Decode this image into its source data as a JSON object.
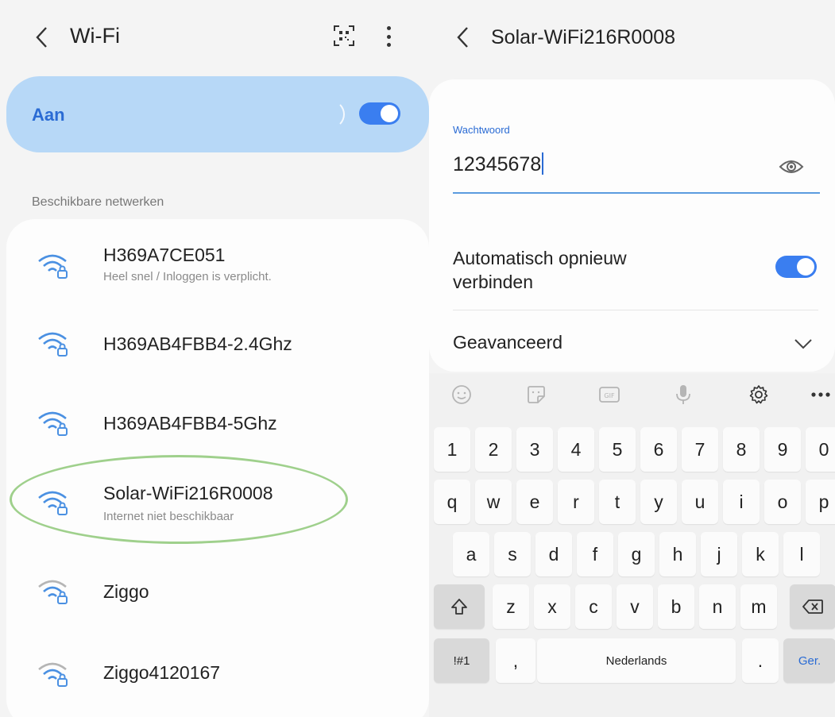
{
  "wifi_list": {
    "title": "Wi-Fi",
    "on_label": "Aan",
    "section_label": "Beschikbare netwerken",
    "networks": [
      {
        "name": "H369A7CE051",
        "status": "Heel snel / Inloggen is verplicht."
      },
      {
        "name": "H369AB4FBB4-2.4Ghz",
        "status": ""
      },
      {
        "name": "H369AB4FBB4-5Ghz",
        "status": ""
      },
      {
        "name": "Solar-WiFi216R0008",
        "status": "Internet niet beschikbaar"
      },
      {
        "name": "Ziggo",
        "status": ""
      },
      {
        "name": "Ziggo4120167",
        "status": ""
      }
    ],
    "highlighted_network": "Solar-WiFi216R0008",
    "wifi_enabled": true
  },
  "network_detail": {
    "title": "Solar-WiFi216R0008",
    "password_label": "Wachtwoord",
    "password_value": "12345678",
    "auto_reconnect_label": "Automatisch opnieuw verbinden",
    "auto_reconnect_enabled": true,
    "advanced_label": "Geavanceerd"
  },
  "keyboard": {
    "toolbar_icons": [
      "emoji-icon",
      "sticker-icon",
      "gif-icon",
      "microphone-icon",
      "gear-icon",
      "more-icon"
    ],
    "row_numbers": [
      "1",
      "2",
      "3",
      "4",
      "5",
      "6",
      "7",
      "8",
      "9",
      "0"
    ],
    "row_top": [
      "q",
      "w",
      "e",
      "r",
      "t",
      "y",
      "u",
      "i",
      "o",
      "p"
    ],
    "row_home": [
      "a",
      "s",
      "d",
      "f",
      "g",
      "h",
      "j",
      "k",
      "l"
    ],
    "row_bottom": [
      "z",
      "x",
      "c",
      "v",
      "b",
      "n",
      "m"
    ],
    "symbols_key": "!#1",
    "comma_key": ",",
    "space_label": "Nederlands",
    "period_key": ".",
    "enter_label": "Ger."
  },
  "colors": {
    "accent": "#3a7ef0",
    "on_bar": "#b7d8f7",
    "highlight_ring": "#9fd08c",
    "wifi_icon_active": "#4a90e2",
    "wifi_icon_weak": "#aaaaaa"
  }
}
